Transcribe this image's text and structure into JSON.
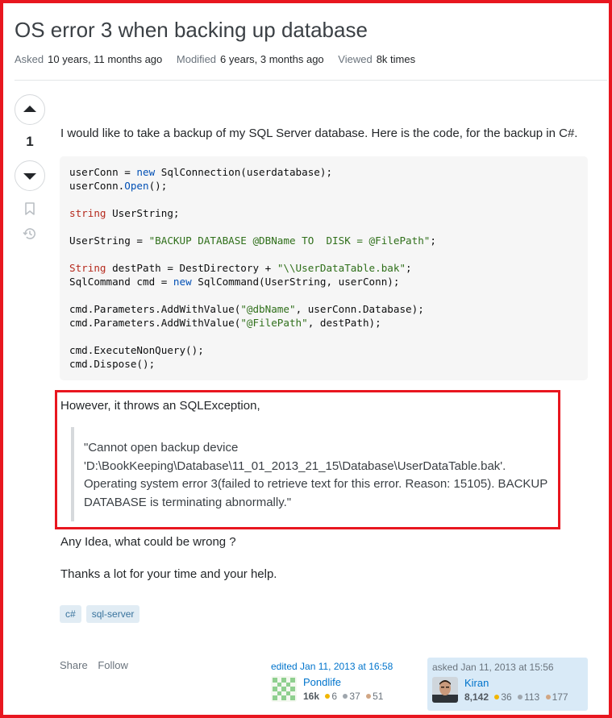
{
  "question": {
    "title": "OS error 3 when backing up database",
    "meta": {
      "asked_label": "Asked",
      "asked_value": "10 years, 11 months ago",
      "modified_label": "Modified",
      "modified_value": "6 years, 3 months ago",
      "viewed_label": "Viewed",
      "viewed_value": "8k times"
    },
    "votes": "1",
    "body": {
      "intro": "I would like to take a backup of my SQL Server database. Here is the code, for the backup in C#.",
      "code_lines": [
        "userConn = new SqlConnection(userdatabase);",
        "userConn.Open();",
        "",
        "string UserString;",
        "",
        "UserString = \"BACKUP DATABASE @DBName TO  DISK = @FilePath\";",
        "",
        "String destPath = DestDirectory + \"\\\\UserDataTable.bak\";",
        "SqlCommand cmd = new SqlCommand(UserString, userConn);",
        "",
        "cmd.Parameters.AddWithValue(\"@dbName\", userConn.Database);",
        "cmd.Parameters.AddWithValue(\"@FilePath\", destPath);",
        "",
        "cmd.ExecuteNonQuery();",
        "cmd.Dispose();"
      ],
      "exception_intro": "However, it throws an SQLException,",
      "quote": "\"Cannot open backup device 'D:\\BookKeeping\\Database\\11_01_2013_21_15\\Database\\UserDataTable.bak'. Operating system error 3(failed to retrieve text for this error. Reason: 15105). BACKUP DATABASE is terminating abnormally.\"",
      "question_line": "Any Idea, what could be wrong ?",
      "thanks_line": "Thanks a lot for your time and your help."
    },
    "tags": [
      "c#",
      "sql-server"
    ],
    "actions": {
      "share": "Share",
      "follow": "Follow"
    },
    "edited": {
      "label": "edited Jan 11, 2013 at 16:58",
      "user": "Pondlife",
      "rep": "16k",
      "gold": "6",
      "silver": "37",
      "bronze": "51"
    },
    "asked": {
      "label": "asked Jan 11, 2013 at 15:56",
      "user": "Kiran",
      "rep": "8,142",
      "gold": "36",
      "silver": "113",
      "bronze": "177"
    }
  },
  "colors": {
    "highlight_border": "#e8161f",
    "link": "#0074cc",
    "tag_bg": "#e1ecf4",
    "tag_text": "#39739d",
    "owner_card_bg": "#d9eaf7"
  },
  "icons": [
    "upvote-icon",
    "downvote-icon",
    "bookmark-icon",
    "history-icon",
    "identicon-avatar",
    "user-photo-avatar"
  ]
}
